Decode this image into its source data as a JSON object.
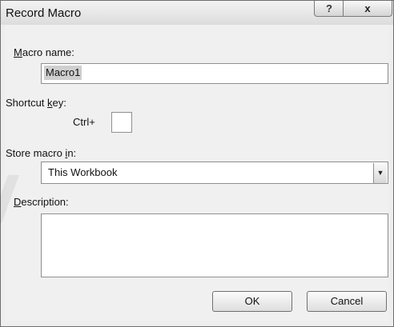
{
  "window": {
    "title": "Record Macro",
    "help_label": "?",
    "close_label": "x"
  },
  "macro_name": {
    "label_prefix": "",
    "label_mnemonic": "M",
    "label_rest": "acro name:",
    "value": "Macro1"
  },
  "shortcut_key": {
    "label_prefix": "Shortcut ",
    "label_mnemonic": "k",
    "label_rest": "ey:",
    "ctrl_label": "Ctrl+",
    "value": ""
  },
  "store_macro": {
    "label_prefix": "Store macro ",
    "label_mnemonic": "i",
    "label_rest": "n:",
    "selected": "This Workbook",
    "dropdown_icon": "triangle-down-icon"
  },
  "description": {
    "label_prefix": "",
    "label_mnemonic": "D",
    "label_rest": "escription:",
    "value": ""
  },
  "buttons": {
    "ok": "OK",
    "cancel": "Cancel"
  }
}
